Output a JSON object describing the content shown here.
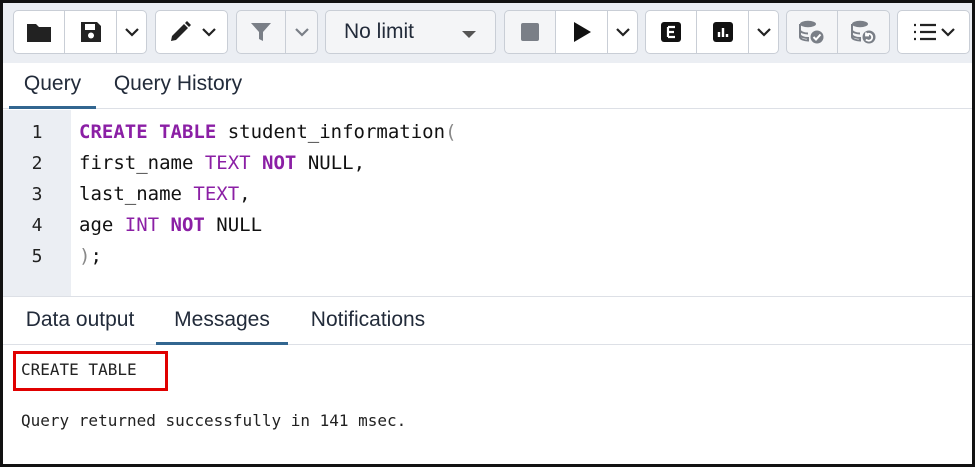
{
  "toolbar": {
    "limit_label": "No limit"
  },
  "tabs": [
    {
      "label": "Query"
    },
    {
      "label": "Query History"
    }
  ],
  "editor": {
    "lines": [
      {
        "number": "1"
      },
      {
        "number": "2"
      },
      {
        "number": "3"
      },
      {
        "number": "4"
      },
      {
        "number": "5"
      }
    ],
    "tokens": {
      "l1_a": "CREATE TABLE",
      "l1_b": " student_information",
      "l1_c": "(",
      "l2_a": "first_name ",
      "l2_b": "TEXT",
      "l2_c": " NOT",
      "l2_d": " NULL,",
      "l3_a": "last_name ",
      "l3_b": "TEXT",
      "l3_c": ",",
      "l4_a": "age ",
      "l4_b": "INT",
      "l4_c": " NOT",
      "l4_d": " NULL",
      "l5_a": ")",
      "l5_b": ";"
    }
  },
  "output_tabs": [
    {
      "label": "Data output"
    },
    {
      "label": "Messages"
    },
    {
      "label": "Notifications"
    }
  ],
  "messages": {
    "result": "CREATE TABLE",
    "status": "Query returned successfully in 141 msec."
  }
}
